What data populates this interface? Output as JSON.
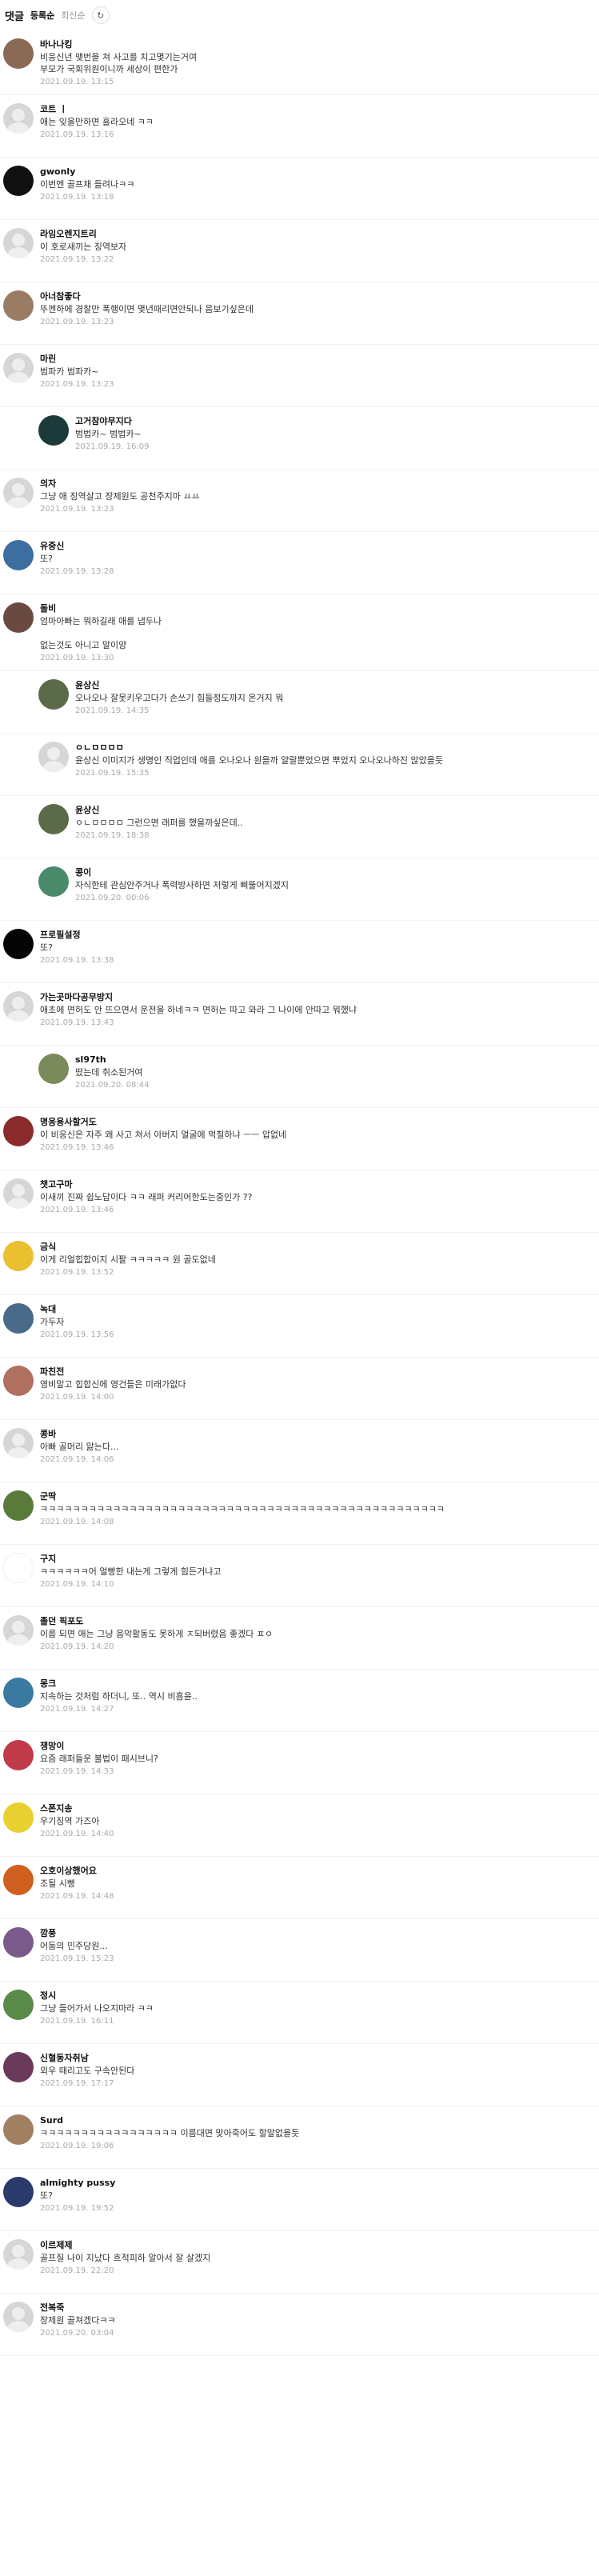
{
  "header": {
    "title": "댓글",
    "sort_active": "등록순",
    "sort_other": "최신순",
    "refresh_glyph": "↻"
  },
  "comments": [
    {
      "nick": "바나나킹",
      "text": "비응신년 맺번을 쳐 사고를 치고몇기는거여\n부모가 국회위원이니까 세상이 편한가",
      "date": "2021.09.19. 13:15",
      "avatar": "#8a6a55",
      "reply": false,
      "blank": false
    },
    {
      "nick": "코트 ㅣ",
      "text": "애는 잊을만하면 흘라오네 ㅋㅋ",
      "date": "2021.09.19. 13:16",
      "avatar": "",
      "reply": false,
      "blank": true
    },
    {
      "nick": "gwonly",
      "text": "이번엔 골프채 들려나ㅋㅋ",
      "date": "2021.09.19. 13:18",
      "avatar": "#111111",
      "reply": false,
      "blank": false
    },
    {
      "nick": "라임오렌지트리",
      "text": "이 호로새끼는 징역보자",
      "date": "2021.09.19. 13:22",
      "avatar": "",
      "reply": false,
      "blank": true
    },
    {
      "nick": "아너참좋다",
      "text": "뚜껜하에 경찰만 폭행이면 몇년때리면안되나 음보기싶은데",
      "date": "2021.09.19. 13:23",
      "avatar": "#9a7b64",
      "reply": false,
      "blank": false
    },
    {
      "nick": "마린",
      "text": "범파카 범파카~",
      "date": "2021.09.19. 13:23",
      "avatar": "",
      "reply": false,
      "blank": true
    },
    {
      "nick": "고거참야무지다",
      "text": "범법카~ 범법카~",
      "date": "2021.09.19. 16:09",
      "avatar": "#1d3a3a",
      "reply": true,
      "blank": false
    },
    {
      "nick": "의자",
      "text": "그냥 애 징역살고 장제원도 공천주지마 ㅛㅛ",
      "date": "2021.09.19. 13:23",
      "avatar": "",
      "reply": false,
      "blank": true
    },
    {
      "nick": "유중신",
      "text": "또?",
      "date": "2021.09.19. 13:28",
      "avatar": "#3d6ea0",
      "reply": false,
      "blank": false
    },
    {
      "nick": "돌비",
      "text": "엄마아빠는 뭐하길래 애를 냅두나\n\n없는것도 아니고 말이양",
      "date": "2021.09.19. 13:30",
      "avatar": "#6a4a40",
      "reply": false,
      "blank": false
    },
    {
      "nick": "윤상신",
      "text": "오나오나 잘못키우고다가 손쓰기 힘들정도까지 온거지 뭐",
      "date": "2021.09.19. 14:35",
      "avatar": "#5b6b4a",
      "reply": true,
      "blank": false
    },
    {
      "nick": "ㅇㄴㅁㅁㅁㅁ",
      "text": "윤상신 이미지가 생명인 직업인데 애를 오나오나 원을까 얄랄뿐었으면 뿌었지 오나오나하진 않았을듯",
      "date": "2021.09.19. 15:35",
      "avatar": "",
      "reply": true,
      "blank": true
    },
    {
      "nick": "윤상신",
      "text": "ㅇㄴㅁㅁㅁㅁ 그런으면 래퍼를 했을까싶은데..",
      "date": "2021.09.19. 18:38",
      "avatar": "#5b6b4a",
      "reply": true,
      "blank": false
    },
    {
      "nick": "콩이",
      "text": "자식한테 관심안주거나 폭력방사하면 저렇게 삐뚤어지겠지",
      "date": "2021.09.20. 00:06",
      "avatar": "#4a8a6a",
      "reply": true,
      "blank": false
    },
    {
      "nick": "프로필설정",
      "text": "또?",
      "date": "2021.09.19. 13:38",
      "avatar": "#050505",
      "reply": false,
      "blank": false
    },
    {
      "nick": "가는곳마다공무방지",
      "text": "애초에 면허도 안 뜨으면서 운전을 하네ㅋㅋ 면허는 따고 와라 그 나이에 안따고 뭐했냐",
      "date": "2021.09.19. 13:43",
      "avatar": "",
      "reply": false,
      "blank": true
    },
    {
      "nick": "sl97th",
      "text": "땄는데 취소된거여",
      "date": "2021.09.20. 08:44",
      "avatar": "#7a8a5a",
      "reply": true,
      "blank": false
    },
    {
      "nick": "명응용사할거도",
      "text": "이 비응신은 자주 왜 사고 쳐서 아버지 얼굴에 먹칠하냐 ㅡㅡ 압없네",
      "date": "2021.09.19. 13:46",
      "avatar": "#8a2a2a",
      "reply": false,
      "blank": false
    },
    {
      "nick": "챗고구마",
      "text": "이새끼 진짜 쉽노답이다 ㅋㅋ 래퍼 커리어한도는중인가 ??",
      "date": "2021.09.19. 13:46",
      "avatar": "",
      "reply": false,
      "blank": true
    },
    {
      "nick": "금식",
      "text": "이게 리얼힙합이지 시팔 ㅋㅋㅋㅋㅋ 원 골도없네",
      "date": "2021.09.19. 13:52",
      "avatar": "#e8c030",
      "reply": false,
      "blank": false
    },
    {
      "nick": "녹대",
      "text": "가두자",
      "date": "2021.09.19. 13:56",
      "avatar": "#4a6a8a",
      "reply": false,
      "blank": false
    },
    {
      "nick": "파친전",
      "text": "영비말고 힙합신에 영건들은 미래가없다",
      "date": "2021.09.19. 14:00",
      "avatar": "#b07060",
      "reply": false,
      "blank": false
    },
    {
      "nick": "콩바",
      "text": "아빠 골머리 앓는다...",
      "date": "2021.09.19. 14:06",
      "avatar": "",
      "reply": false,
      "blank": true
    },
    {
      "nick": "군딱",
      "text": "ㅋㅋㅋㅋㅋㅋㅋㅋㅋㅋㅋㅋㅋㅋㅋㅋㅋㅋㅋㅋㅋㅋㅋㅋㅋㅋㅋㅋㅋㅋㅋㅋㅋㅋㅋㅋㅋㅋㅋㅋㅋㅋㅋㅋㅋㅋㅋㅋㅋㅋ",
      "date": "2021.09.19. 14:08",
      "avatar": "#5a7a3a",
      "reply": false,
      "blank": false
    },
    {
      "nick": "구지",
      "text": "ㅋㅋㅋㅋㅋㅋ어 얼빵한 내는게 그렇게 힘든거냐고",
      "date": "2021.09.19. 14:10",
      "avatar": "#ffffff",
      "reply": false,
      "blank": false
    },
    {
      "nick": "졸던 픽포도",
      "text": "이름 되면 애는 그냥 음악활동도 못하게 ㅈ되버렸음 좋겠다 ㅍㅇ",
      "date": "2021.09.19. 14:20",
      "avatar": "",
      "reply": false,
      "blank": true
    },
    {
      "nick": "몽크",
      "text": "지속하는 것처럼 하더니, 또.. 역시 비흠윤..",
      "date": "2021.09.19. 14:27",
      "avatar": "#3a7aa0",
      "reply": false,
      "blank": false
    },
    {
      "nick": "쟁망이",
      "text": "요즘 래퍼들운 불법이 패시브니?",
      "date": "2021.09.19. 14:33",
      "avatar": "#c03a4a",
      "reply": false,
      "blank": false
    },
    {
      "nick": "스폰지송",
      "text": "우기징역 가즈아",
      "date": "2021.09.19. 14:40",
      "avatar": "#e8d030",
      "reply": false,
      "blank": false
    },
    {
      "nick": "오호이상했어요",
      "text": "조될 시빵",
      "date": "2021.09.19. 14:48",
      "avatar": "#d06020",
      "reply": false,
      "blank": false
    },
    {
      "nick": "깜풍",
      "text": "어둠의 민주당원...",
      "date": "2021.09.19. 15:23",
      "avatar": "#7a5a8a",
      "reply": false,
      "blank": false
    },
    {
      "nick": "정시",
      "text": "그냥 들어가서 나오지마라 ㅋㅋ",
      "date": "2021.09.19. 16:11",
      "avatar": "#5a8a4a",
      "reply": false,
      "blank": false
    },
    {
      "nick": "신혈동자취남",
      "text": "외우 때리고도 구속안된다",
      "date": "2021.09.19. 17:17",
      "avatar": "#6a3a5a",
      "reply": false,
      "blank": false
    },
    {
      "nick": "Surd",
      "text": "ㅋㅋㅋㅋㅋㅋㅋㅋㅋㅋㅋㅋㅋㅋㅋㅋㅋ 이름대면 맞아죽어도 할말없을듯",
      "date": "2021.09.19. 19:06",
      "avatar": "#a08060",
      "reply": false,
      "blank": false
    },
    {
      "nick": "almighty pussy",
      "text": "또?",
      "date": "2021.09.19. 19:52",
      "avatar": "#2a3a6a",
      "reply": false,
      "blank": false
    },
    {
      "nick": "이르제제",
      "text": "골프질 나이 지났다 흐적피하 알아서 잘 살겠지",
      "date": "2021.09.19. 22:20",
      "avatar": "",
      "reply": false,
      "blank": true
    },
    {
      "nick": "전복죽",
      "text": "장제원 골쳐겠다ㅋㅋ",
      "date": "2021.09.20. 03:04",
      "avatar": "",
      "reply": false,
      "blank": true
    }
  ]
}
